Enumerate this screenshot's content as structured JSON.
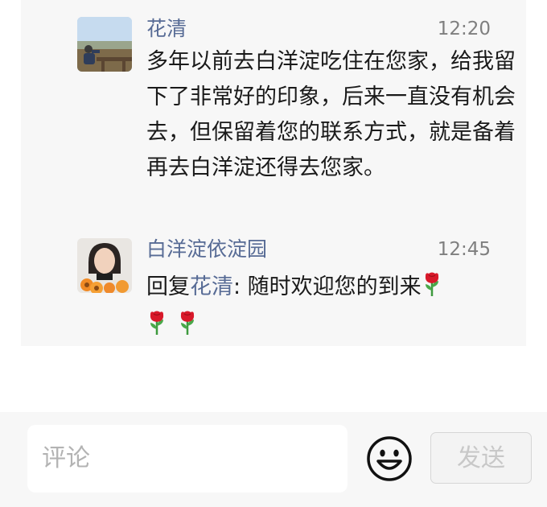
{
  "comments": [
    {
      "name": "花清",
      "time": "12:20",
      "text": "多年以前去白洋淀吃住在您家，给我留下了非常好的印象，后来一直没有机会去，但保留着您的联系方式，就是备着再去白洋淀还得去您家。"
    },
    {
      "name": "白洋淀依淀园",
      "time": "12:45",
      "reply_prefix": "回复",
      "reply_to": "花清",
      "text": ": 随时欢迎您的到来",
      "trailing_icons": [
        "rose-emoji",
        "rose-emoji",
        "rose-emoji"
      ]
    }
  ],
  "input": {
    "placeholder": "评论"
  },
  "emoji_button_icon": "smiley-face-icon",
  "send_label": "发送",
  "colors": {
    "name_link": "#576b95",
    "time": "#7f7f7f",
    "panel_bg": "#f7f7f7",
    "send_disabled_text": "#c8c8c8"
  }
}
